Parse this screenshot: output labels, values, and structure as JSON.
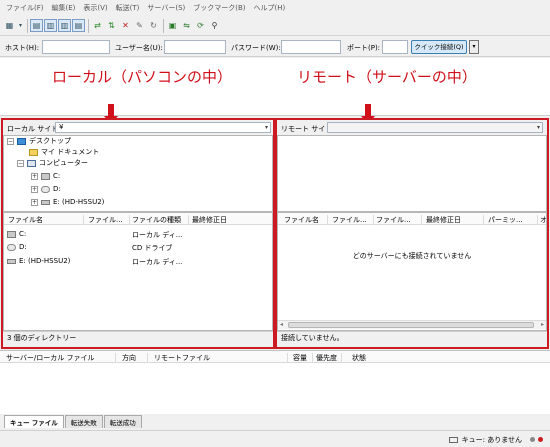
{
  "menu": [
    "ファイル(F)",
    "編集(E)",
    "表示(V)",
    "転送(T)",
    "サーバー(S)",
    "ブックマーク(B)",
    "ヘルプ(H)"
  ],
  "toolbar_icons": [
    "site-manager-icon",
    "dropdown-arrow-icon",
    "toggle-message-log-icon",
    "toggle-local-tree-icon",
    "toggle-remote-tree-icon",
    "toggle-queue-icon",
    "refresh-icon",
    "process-queue-icon",
    "cancel-icon",
    "disconnect-icon",
    "reconnect-icon",
    "directory-filter-icon",
    "compare-icon",
    "sync-browse-icon",
    "search-icon"
  ],
  "quickconnect": {
    "host_label": "ホスト(H):",
    "user_label": "ユーザー名(U):",
    "password_label": "パスワード(W):",
    "port_label": "ポート(P):",
    "connect_button": "クイック接続(Q)",
    "host_value": "",
    "user_value": "",
    "password_value": "",
    "port_value": ""
  },
  "annotations": {
    "local": "ローカル（パソコンの中）",
    "remote": "リモート（サーバーの中）"
  },
  "local": {
    "site_label": "ローカル サイト:",
    "site_value": "¥",
    "tree": {
      "desktop": "デスクトップ",
      "my_documents": "マイ ドキュメント",
      "computer": "コンピューター",
      "drive_c": "C:",
      "drive_d": "D:",
      "drive_e": "E: (HD-HSSU2)"
    },
    "columns": [
      "ファイル名",
      "ファイル...",
      "ファイルの種類",
      "最終修正日"
    ],
    "rows": [
      {
        "icon": "local-disk-icon",
        "name": "C:",
        "size": "",
        "type": "ローカル ディ...",
        "modified": ""
      },
      {
        "icon": "cd-drive-icon",
        "name": "D:",
        "size": "",
        "type": "CD ドライブ",
        "modified": ""
      },
      {
        "icon": "network-drive-icon",
        "name": "E: (HD-HSSU2)",
        "size": "",
        "type": "ローカル ディ...",
        "modified": ""
      }
    ],
    "status": "3 個のディレクトリー"
  },
  "remote": {
    "site_label": "リモート サイト:",
    "site_value": "",
    "columns": [
      "ファイル名",
      "ファイル...",
      "ファイル...",
      "最終修正日",
      "パーミッ...",
      "オ"
    ],
    "empty_message": "どのサーバーにも接続されていません",
    "status": "接続していません。"
  },
  "queue": {
    "columns": [
      "サーバー/ローカル ファイル",
      "方向",
      "リモートファイル",
      "容量",
      "優先度",
      "状態"
    ],
    "tabs": [
      "キュー ファイル",
      "転送失敗",
      "転送成功"
    ],
    "status": "キュー: ありません"
  }
}
